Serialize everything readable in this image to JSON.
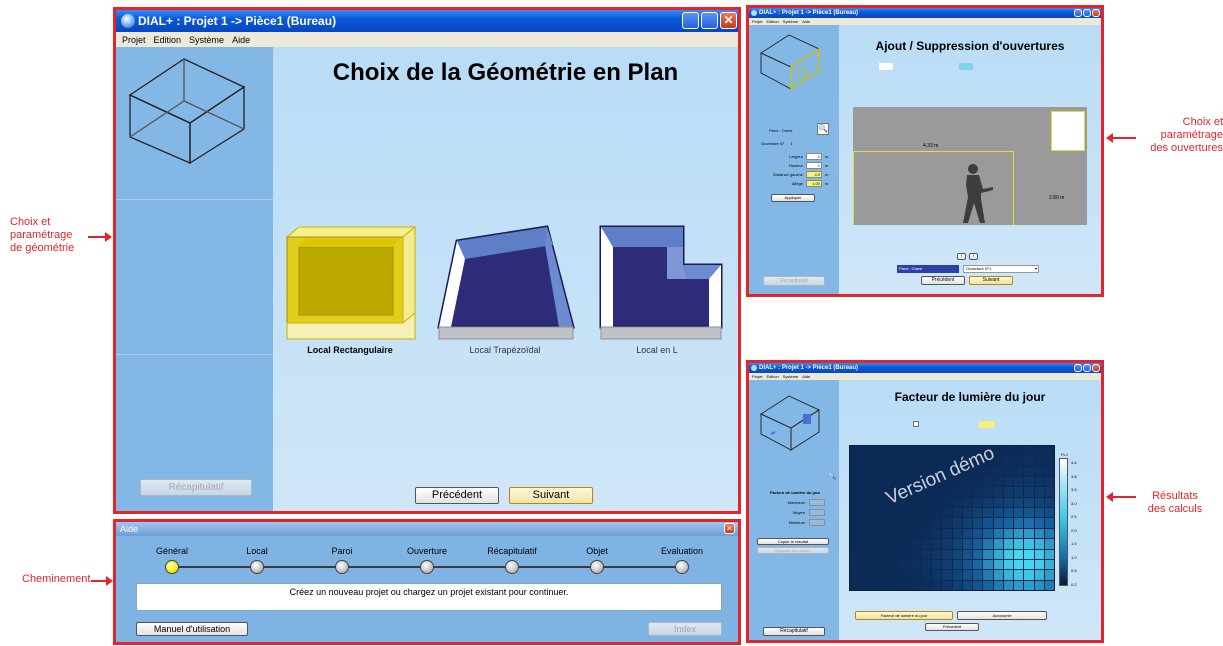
{
  "annotations": {
    "geometry": "Choix et\nparamétrage\nde géométrie",
    "path": "Cheminement",
    "openings": "Choix et\nparamétrage\ndes ouvertures",
    "results": "Résultats\ndes calculs"
  },
  "main_window": {
    "title": "DIAL+ : Projet 1 -> Pièce1 (Bureau)",
    "menu": [
      "Projet",
      "Edition",
      "Système",
      "Aide"
    ],
    "heading": "Choix de la Géométrie en Plan",
    "options": [
      {
        "label": "Local Rectangulaire",
        "selected": true
      },
      {
        "label": "Local Trapézoïdal",
        "selected": false
      },
      {
        "label": "Local en L",
        "selected": false
      }
    ],
    "summary_button": "Récapitulatif",
    "prev_button": "Précédent",
    "next_button": "Suivant"
  },
  "help_panel": {
    "title": "Aide",
    "steps": [
      "Général",
      "Local",
      "Paroi",
      "Ouverture",
      "Récapitulatif",
      "Objet",
      "Evaluation"
    ],
    "current_step": 0,
    "message": "Créez un nouveau projet ou chargez un projet existant pour continuer.",
    "manual_button": "Manuel d'utilisation",
    "index_button": "Index"
  },
  "openings_window": {
    "title": "DIAL+ : Projet 1 -> Pièce1 (Bureau)",
    "menu": [
      "Projet",
      "Edition",
      "Système",
      "Aide"
    ],
    "heading": "Ajout / Suppression d'ouvertures",
    "wall_label": "Paroi : Ouest",
    "opening_label": "Ouverture N°",
    "opening_number": "1",
    "fields": [
      {
        "label": "Largeur",
        "value": "1",
        "unit": "m",
        "highlight": false
      },
      {
        "label": "Hauteur",
        "value": "1",
        "unit": "m",
        "highlight": false
      },
      {
        "label": "Distance gauche",
        "value": "4.0",
        "unit": "m",
        "highlight": true
      },
      {
        "label": "Allège",
        "value": "1.00",
        "unit": "m",
        "highlight": true
      }
    ],
    "apply_button": "Appliquer",
    "dim_width": "4.33 m",
    "dim_height": "2.80 m",
    "wall_select": "Paroi : Ouest",
    "opening_select": "Ouverture N°1",
    "summary_button": "Récapitulatif",
    "prev_button": "Précédent",
    "next_button": "Suivant"
  },
  "results_window": {
    "title": "DIAL+ : Projet 1 -> Pièce1 (Bureau)",
    "menu": [
      "Projet",
      "Edition",
      "Système",
      "Aide"
    ],
    "heading": "Facteur de lumière du jour",
    "stats_title": "Facteur de lumière du jour",
    "stats": [
      "Maximum",
      "Moyen",
      "Minimum"
    ],
    "copy_button": "Copier le résultat",
    "export_button": "Exporter les valeurs",
    "watermark": "Version démo",
    "legend_title": "FLJ",
    "legend_ticks": [
      "4.6",
      "3.8",
      "3.5",
      "3.0",
      "2.5",
      "2.0",
      "1.5",
      "1.0",
      "0.5",
      "0.2"
    ],
    "summary_button": "Récapitulatif",
    "tab_dlf": "Facteur de lumière du jour",
    "tab_autonomy": "Autonomie",
    "prev_button": "Précédent"
  }
}
